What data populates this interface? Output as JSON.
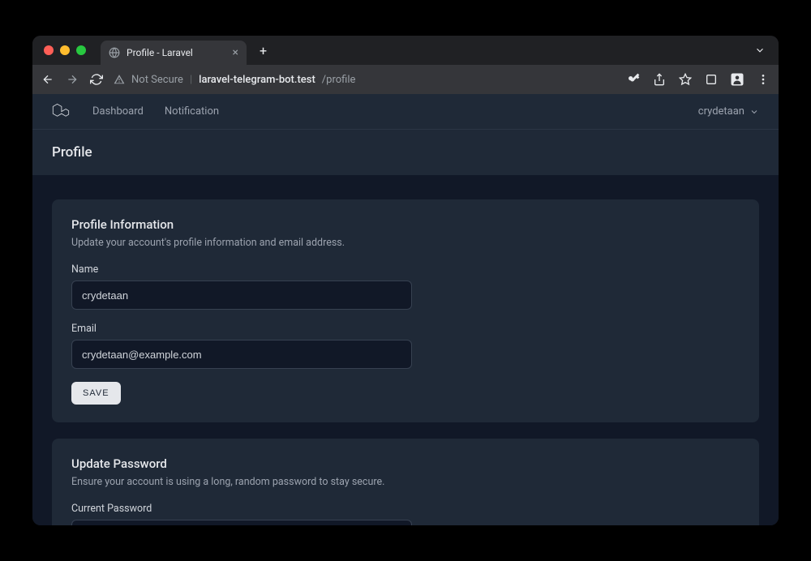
{
  "browser": {
    "tab_title": "Profile - Laravel",
    "security_label": "Not Secure",
    "url_host": "laravel-telegram-bot.test",
    "url_path": "/profile"
  },
  "nav": {
    "links": [
      "Dashboard",
      "Notification"
    ],
    "user": "crydetaan"
  },
  "page": {
    "title": "Profile"
  },
  "profile_card": {
    "title": "Profile Information",
    "desc": "Update your account's profile information and email address.",
    "name_label": "Name",
    "name_value": "crydetaan",
    "email_label": "Email",
    "email_value": "crydetaan@example.com",
    "save_label": "SAVE"
  },
  "password_card": {
    "title": "Update Password",
    "desc": "Ensure your account is using a long, random password to stay secure.",
    "current_label": "Current Password",
    "current_value": ""
  }
}
